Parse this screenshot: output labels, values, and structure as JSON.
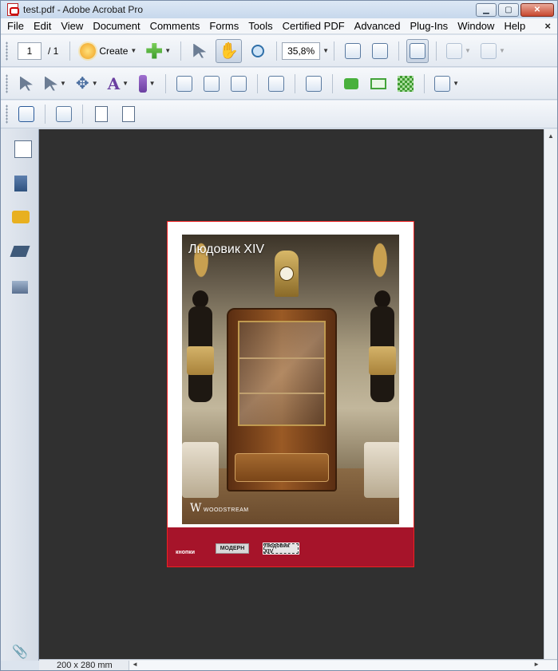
{
  "window": {
    "title": "test.pdf - Adobe Acrobat Pro",
    "buttons": {
      "minimize": "▁",
      "maximize": "▢",
      "close": "✕"
    }
  },
  "menu": {
    "items": [
      "File",
      "Edit",
      "View",
      "Document",
      "Comments",
      "Forms",
      "Tools",
      "Certified PDF",
      "Advanced",
      "Plug-Ins",
      "Window",
      "Help"
    ],
    "close_doc": "×"
  },
  "toolbar": {
    "page_current": "1",
    "page_total": "/ 1",
    "create_label": "Create",
    "zoom_value": "35,8%"
  },
  "icons": {
    "toolbar1": [
      "create-icon",
      "combine-icon",
      "select-text-icon",
      "hand-icon",
      "zoom-icon",
      "fit-width-icon",
      "fit-page-icon",
      "two-up-icon",
      "back-icon",
      "forward-icon"
    ],
    "toolbar2": [
      "select-object-icon",
      "link-tool-icon",
      "move-icon",
      "text-touchup-icon",
      "pen-tool-icon",
      "form-checkbox-icon",
      "form-button-icon",
      "form-image-icon",
      "filter-icon",
      "crop-icon",
      "comment-icon",
      "email-icon",
      "pattern-icon",
      "sidebar-icon"
    ],
    "toolbar3": [
      "crop-tool-icon",
      "edit-form-icon",
      "page-box-icon",
      "replace-pages-icon"
    ],
    "nav": [
      "pages-icon",
      "bookmarks-icon",
      "comments-icon",
      "layers-icon",
      "signatures-icon",
      "attachments-icon"
    ]
  },
  "document": {
    "photo_title": "Людовик XIV",
    "logo_text": "WOODSTREAM",
    "logo_mark": "W",
    "footer_label": "кнопки",
    "button_modern": "МОДЕРН",
    "button_ludovic": "Людовик XIV",
    "band_color": "#a6142a"
  },
  "status": {
    "page_size": "200 x 280 mm"
  }
}
